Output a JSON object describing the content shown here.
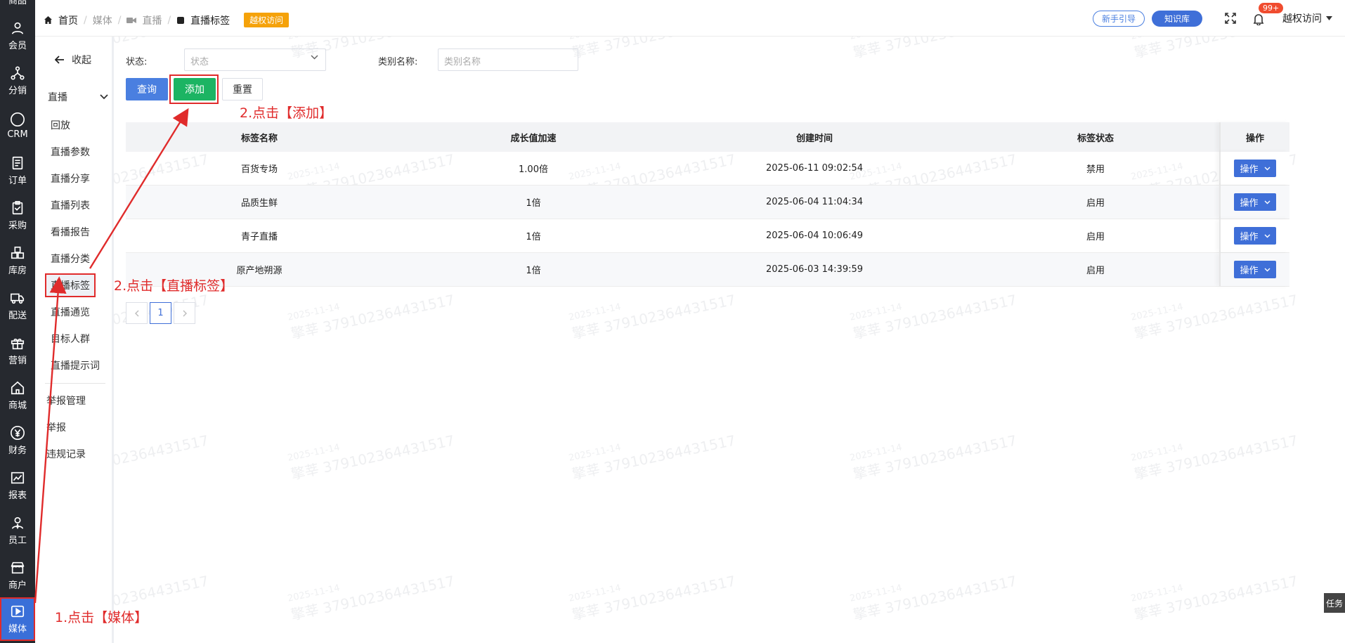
{
  "rail": {
    "items": [
      {
        "label": "商品",
        "icon": "bag-icon"
      },
      {
        "label": "会员",
        "icon": "user-icon"
      },
      {
        "label": "分销",
        "icon": "share-tree-icon"
      },
      {
        "label": "CRM",
        "icon": "crm-icon"
      },
      {
        "label": "订单",
        "icon": "order-icon"
      },
      {
        "label": "采购",
        "icon": "clipboard-icon"
      },
      {
        "label": "库房",
        "icon": "warehouse-icon"
      },
      {
        "label": "配送",
        "icon": "truck-icon"
      },
      {
        "label": "营销",
        "icon": "gift-icon"
      },
      {
        "label": "商城",
        "icon": "home-icon"
      },
      {
        "label": "财务",
        "icon": "yen-icon"
      },
      {
        "label": "报表",
        "icon": "chart-icon"
      },
      {
        "label": "员工",
        "icon": "staff-icon"
      },
      {
        "label": "商户",
        "icon": "store-icon"
      },
      {
        "label": "媒体",
        "icon": "play-icon"
      }
    ]
  },
  "submenu": {
    "collapse_label": "收起",
    "group_label": "直播",
    "items": [
      "回放",
      "直播参数",
      "直播分享",
      "直播列表",
      "看播报告",
      "直播分类",
      "直播标签",
      "直播通览",
      "目标人群",
      "直播提示词"
    ],
    "extra_items": [
      "举报管理",
      "举报",
      "违规记录"
    ]
  },
  "topbar": {
    "breadcrumb": [
      "首页",
      "媒体",
      "直播",
      "直播标签"
    ],
    "badge": "越权访问",
    "guide_btn": "新手引导",
    "kb_btn": "知识库",
    "notif_count": "99+",
    "user_name": "越权访问"
  },
  "filters": {
    "status_label": "状态:",
    "status_placeholder": "状态",
    "category_label": "类别名称:",
    "category_placeholder": "类别名称",
    "query_btn": "查询",
    "add_btn": "添加",
    "reset_btn": "重置"
  },
  "table": {
    "headers": [
      "标签名称",
      "成长值加速",
      "创建时间",
      "标签状态",
      "操作"
    ],
    "rows": [
      {
        "name": "百货专场",
        "speed": "1.00倍",
        "created": "2025-06-11 09:02:54",
        "status": "禁用",
        "action": "操作"
      },
      {
        "name": "品质生鲜",
        "speed": "1倍",
        "created": "2025-06-04 11:04:34",
        "status": "启用",
        "action": "操作"
      },
      {
        "name": "青子直播",
        "speed": "1倍",
        "created": "2025-06-04 10:06:49",
        "status": "启用",
        "action": "操作"
      },
      {
        "name": "原产地朔源",
        "speed": "1倍",
        "created": "2025-06-03 14:39:59",
        "status": "启用",
        "action": "操作"
      }
    ]
  },
  "pager": {
    "current": "1"
  },
  "annotations": {
    "step1": "1.点击【媒体】",
    "step2a": "2.点击【直播标签】",
    "step2b": "2.点击【添加】"
  },
  "task_tab": "任务",
  "watermark": {
    "date": "2025-11-14",
    "text": "擎莘 379102364431517"
  },
  "colors": {
    "rail_bg": "#26292f",
    "primary": "#3f6fd8",
    "add_green": "#1cb463",
    "annotation_red": "#e02b2b",
    "badge_orange": "#f5a20a"
  }
}
